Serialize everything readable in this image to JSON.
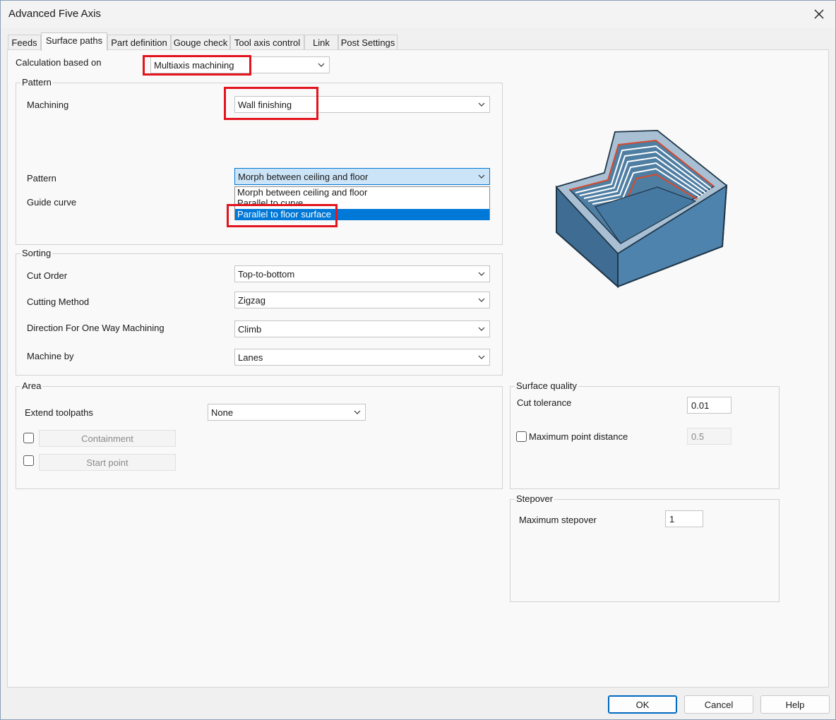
{
  "window": {
    "title": "Advanced Five Axis",
    "close_label": "close"
  },
  "tabs": [
    {
      "label": "Feeds",
      "active": false
    },
    {
      "label": "Surface paths",
      "active": true
    },
    {
      "label": "Part definition",
      "active": false
    },
    {
      "label": "Gouge check",
      "active": false
    },
    {
      "label": "Tool axis control",
      "active": false
    },
    {
      "label": "Link",
      "active": false
    },
    {
      "label": "Post Settings",
      "active": false
    }
  ],
  "calc": {
    "label": "Calculation based on",
    "value": "Multiaxis machining"
  },
  "pattern_group": {
    "title": "Pattern",
    "machining_label": "Machining",
    "machining_value": "Wall finishing",
    "pattern_label": "Pattern",
    "pattern_value": "Morph between ceiling and floor",
    "guide_curve_label": "Guide curve",
    "dropdown_options": [
      "Morph between ceiling and floor",
      "Parallel to curve",
      "Parallel to floor surface"
    ],
    "dropdown_selected_index": 2
  },
  "sorting_group": {
    "title": "Sorting",
    "cut_order_label": "Cut Order",
    "cut_order_value": "Top-to-bottom",
    "cutting_method_label": "Cutting Method",
    "cutting_method_value": "Zigzag",
    "direction_label": "Direction For One Way Machining",
    "direction_value": "Climb",
    "machine_by_label": "Machine by",
    "machine_by_value": "Lanes"
  },
  "area_group": {
    "title": "Area",
    "extend_label": "Extend toolpaths",
    "extend_value": "None",
    "containment_label": "Containment",
    "start_point_label": "Start point"
  },
  "surface_quality": {
    "title": "Surface quality",
    "cut_tolerance_label": "Cut tolerance",
    "cut_tolerance_value": "0.01",
    "max_point_distance_label": "Maximum point distance",
    "max_point_distance_value": "0.5"
  },
  "stepover": {
    "title": "Stepover",
    "max_stepover_label": "Maximum stepover",
    "max_stepover_value": "1"
  },
  "buttons": {
    "ok": "OK",
    "cancel": "Cancel",
    "help": "Help"
  },
  "colors": {
    "accent": "#0078d7",
    "highlight": "#e3141d",
    "part_body": "#4d7fa6",
    "toolpath": "#d94a2c"
  }
}
